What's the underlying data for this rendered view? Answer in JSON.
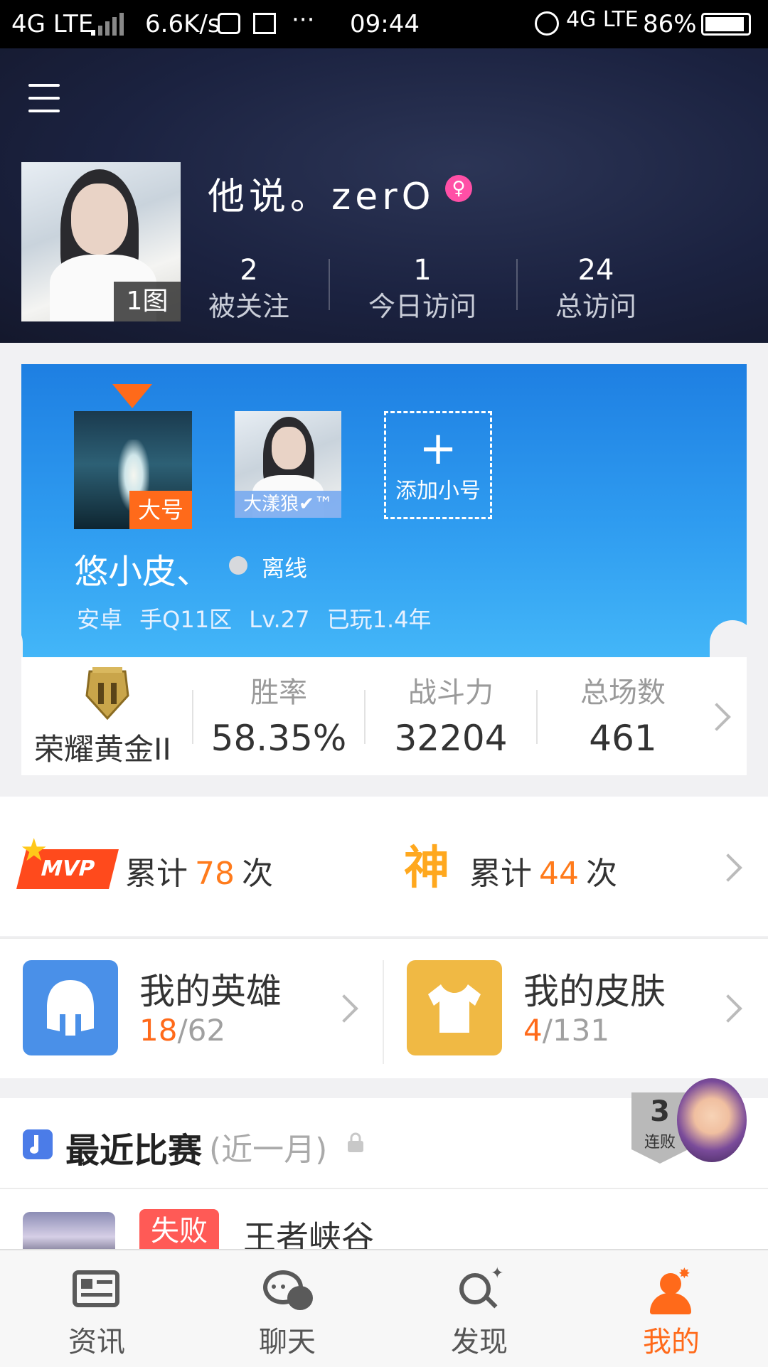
{
  "status_bar": {
    "network_left": "4G LTE",
    "speed": "6.6K/s",
    "dots": "···",
    "time": "09:44",
    "network_right": "4G LTE",
    "battery": "86%"
  },
  "profile": {
    "username": "他说。zerO",
    "gender_symbol": "♀",
    "photo_count": "1图",
    "stats": [
      {
        "num": "2",
        "label": "被关注"
      },
      {
        "num": "1",
        "label": "今日访问"
      },
      {
        "num": "24",
        "label": "总访问"
      }
    ]
  },
  "accounts": {
    "main_tag": "大号",
    "alt_tag": "大漾狼✔™",
    "add_plus": "+",
    "add_label": "添加小号",
    "name": "悠小皮、",
    "status": "离线",
    "meta": "安卓 手Q11区  Lv.27  已玩1.4年"
  },
  "rank": {
    "tier": "荣耀黄金II",
    "columns": [
      {
        "label": "胜率",
        "value": "58.35%"
      },
      {
        "label": "战斗力",
        "value": "32204"
      },
      {
        "label": "总场数",
        "value": "461"
      }
    ]
  },
  "honors": {
    "mvp_badge": "MVP",
    "mvp_prefix": "累计",
    "mvp_count": "78",
    "mvp_suffix": "次",
    "god_badge": "神",
    "god_prefix": "累计",
    "god_count": "44",
    "god_suffix": "次"
  },
  "inventory": {
    "heroes": {
      "title": "我的英雄",
      "owned": "18",
      "total": "/62"
    },
    "skins": {
      "title": "我的皮肤",
      "owned": "4",
      "total": "/131"
    }
  },
  "recent": {
    "title": "最近比赛",
    "subtitle": "(近一月)",
    "streak_num": "3",
    "streak_label": "连败",
    "match_result": "失败",
    "match_map": "王者峡谷"
  },
  "nav": [
    {
      "label": "资讯",
      "icon": "news-icon"
    },
    {
      "label": "聊天",
      "icon": "chat-icon"
    },
    {
      "label": "发现",
      "icon": "discover-icon"
    },
    {
      "label": "我的",
      "icon": "profile-icon"
    }
  ],
  "colors": {
    "accent": "#ff6a1a",
    "card_blue": "#2f9cf0",
    "header_dark": "#1b2240"
  }
}
